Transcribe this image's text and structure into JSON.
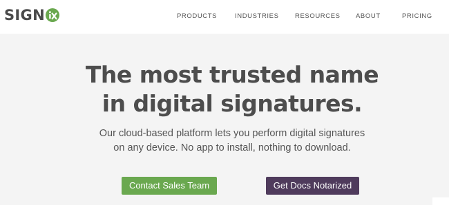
{
  "brand": {
    "logo_text": "SIGN",
    "logo_mark": "iX",
    "logo_mark_color": "#6aa84f"
  },
  "nav": {
    "items": [
      {
        "label": "PRODUCTS"
      },
      {
        "label": "INDUSTRIES"
      },
      {
        "label": "RESOURCES"
      },
      {
        "label": "ABOUT"
      },
      {
        "label": "PRICING"
      }
    ]
  },
  "hero": {
    "title_line1": "The most trusted name",
    "title_line2": "in digital signatures.",
    "subtitle_line1": "Our cloud-based platform lets you perform digital signatures",
    "subtitle_line2": "on any device. No app to install, nothing to download."
  },
  "cta": {
    "primary_label": "Contact Sales Team",
    "primary_color": "#6aa84f",
    "secondary_label": "Get Docs Notarized",
    "secondary_color": "#4f3b5c"
  }
}
